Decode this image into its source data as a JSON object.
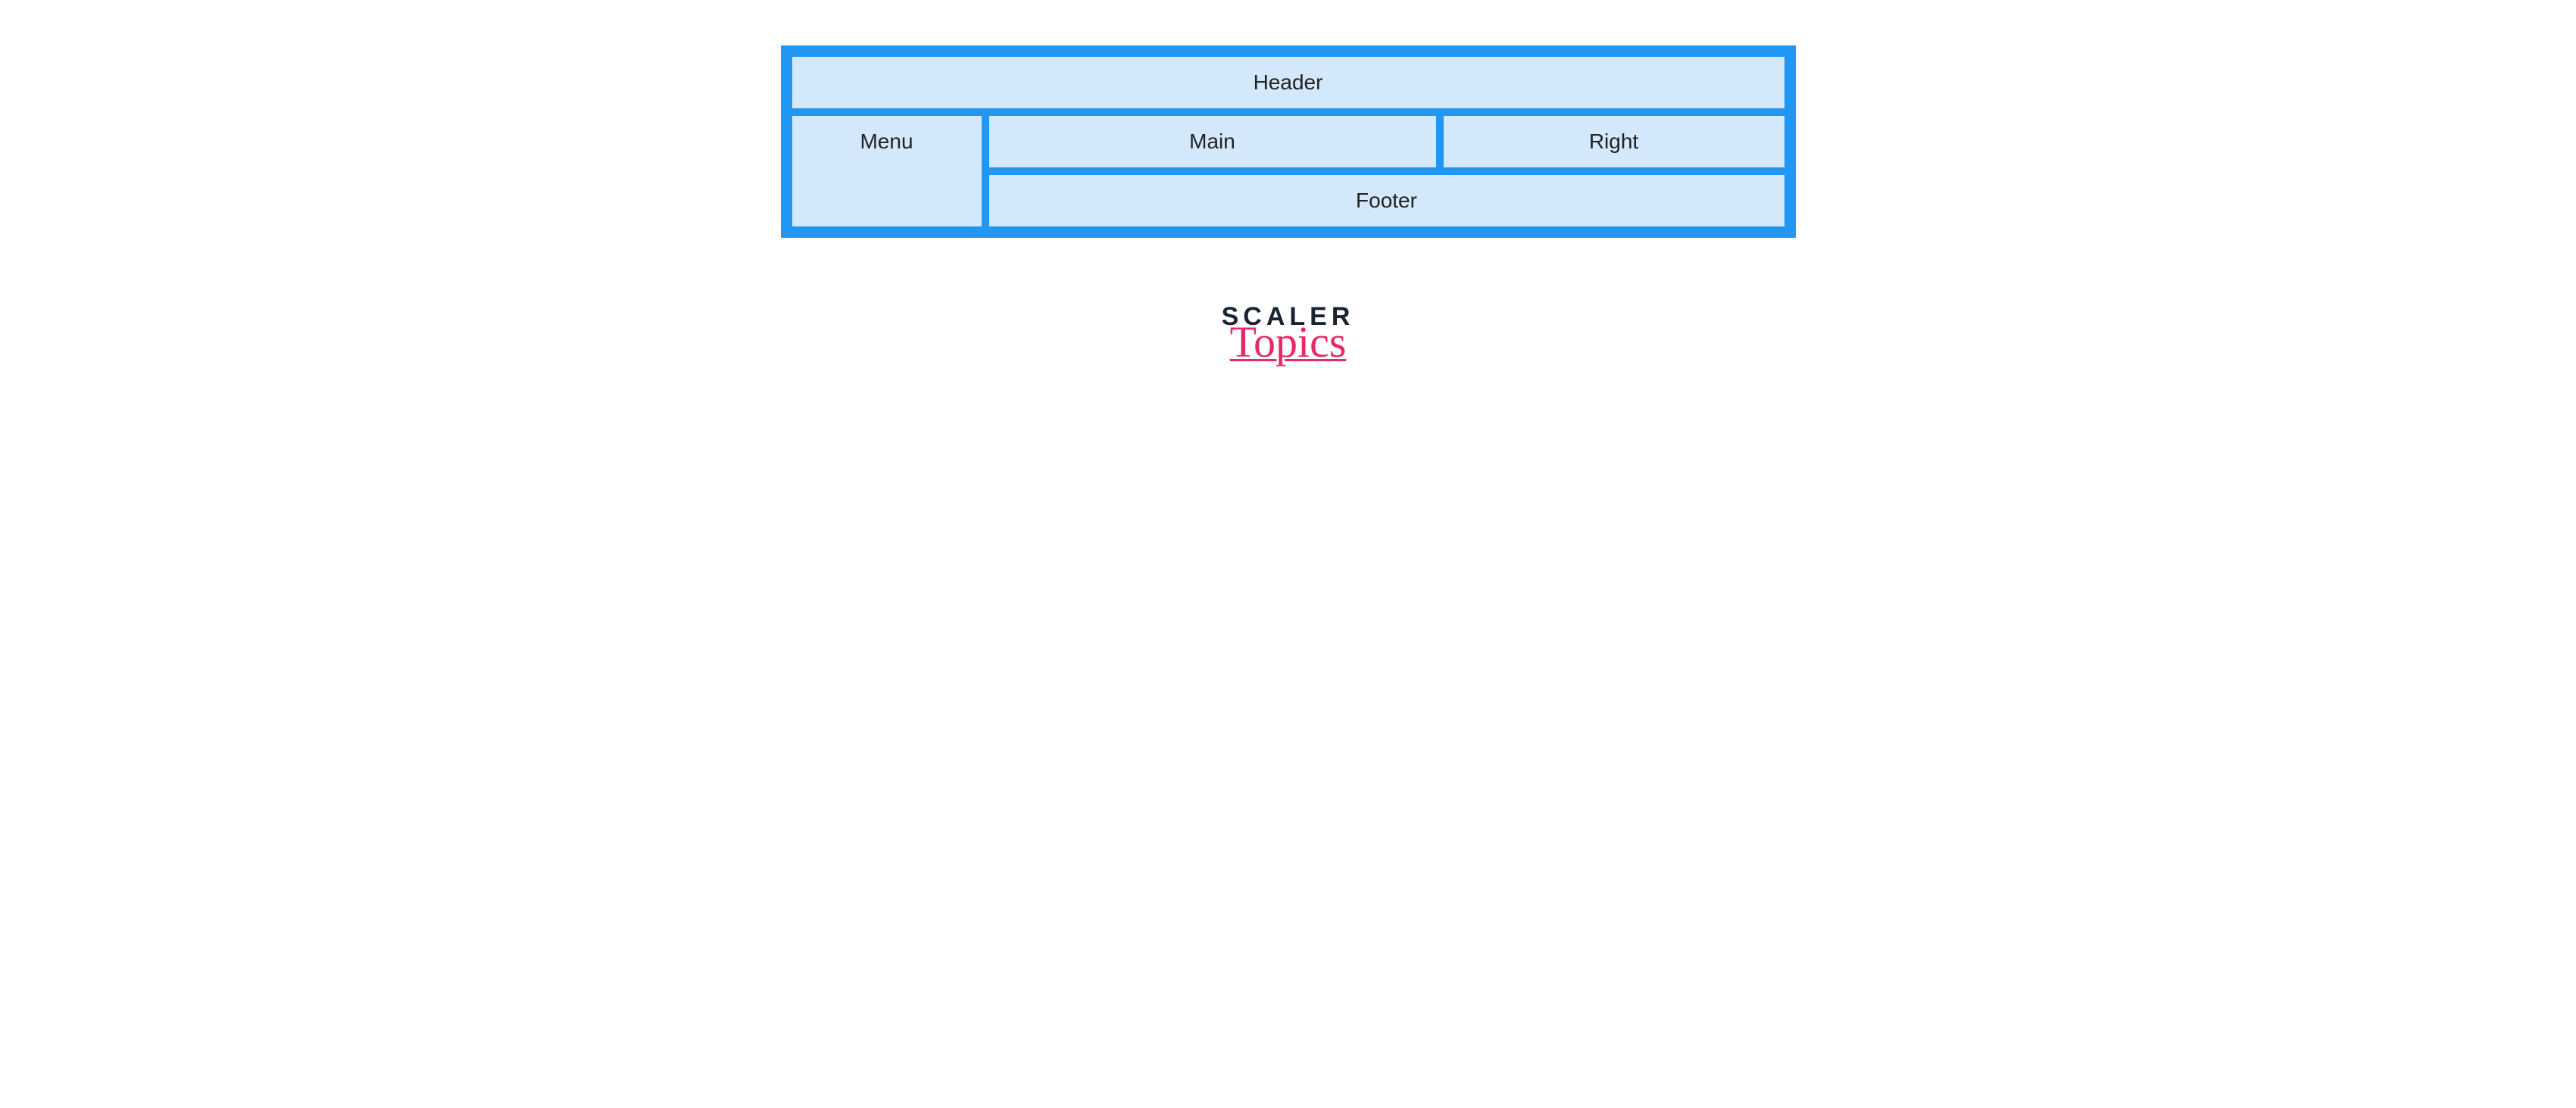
{
  "grid": {
    "header": "Header",
    "menu": "Menu",
    "main": "Main",
    "right": "Right",
    "footer": "Footer"
  },
  "logo": {
    "line1": "SCALER",
    "line2": "Topics"
  }
}
